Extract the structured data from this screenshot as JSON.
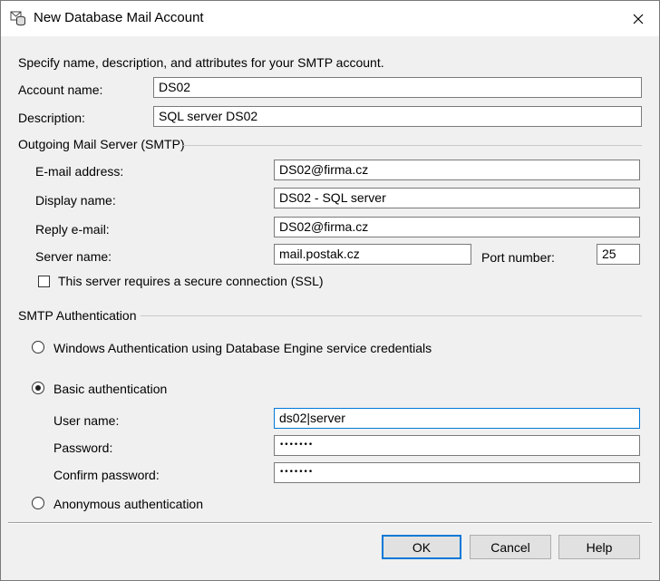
{
  "window": {
    "title": "New Database Mail Account",
    "close_icon": "close-icon",
    "app_icon": "database-mail-icon"
  },
  "intro": "Specify name, description, and attributes for your SMTP account.",
  "account": {
    "name_label": "Account name:",
    "name_value": "DS02",
    "description_label": "Description:",
    "description_value": "SQL server DS02"
  },
  "smtp": {
    "group_label": "Outgoing Mail Server (SMTP)",
    "email_label": "E-mail address:",
    "email_value": "DS02@firma.cz",
    "display_label": "Display name:",
    "display_value": "DS02 - SQL server",
    "reply_label": "Reply e-mail:",
    "reply_value": "DS02@firma.cz",
    "server_label": "Server name:",
    "server_value": "mail.postak.cz",
    "port_label": "Port number:",
    "port_value": "25",
    "ssl_label": "This server requires a secure connection (SSL)",
    "ssl_checked": false
  },
  "auth": {
    "group_label": "SMTP Authentication",
    "windows_label": "Windows Authentication using Database Engine service credentials",
    "basic_label": "Basic authentication",
    "selected": "basic",
    "username_label": "User name:",
    "username_value": "ds02|server",
    "password_label": "Password:",
    "password_value": "•••••••",
    "confirm_label": "Confirm password:",
    "confirm_value": "•••••••",
    "anonymous_label": "Anonymous authentication"
  },
  "buttons": {
    "ok": "OK",
    "cancel": "Cancel",
    "help": "Help"
  }
}
